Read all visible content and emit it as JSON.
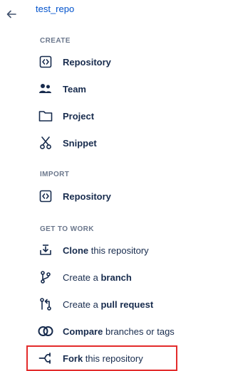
{
  "header": {
    "repo_name": "test_repo"
  },
  "create": {
    "title": "CREATE",
    "repository": "Repository",
    "team": "Team",
    "project": "Project",
    "snippet": "Snippet"
  },
  "import": {
    "title": "IMPORT",
    "repository": "Repository"
  },
  "get_to_work": {
    "title": "GET TO WORK",
    "clone": {
      "bold": "Clone",
      "rest": " this repository"
    },
    "branch": {
      "pre": "Create a ",
      "bold": "branch"
    },
    "pull_request": {
      "pre": "Create a ",
      "bold": "pull request"
    },
    "compare": {
      "bold": "Compare",
      "rest": " branches or tags"
    },
    "fork": {
      "bold": "Fork",
      "rest": " this repository"
    }
  },
  "colors": {
    "link": "#0052cc",
    "text": "#172b4d",
    "header": "#6b778c",
    "highlight": "#e32b2b"
  },
  "icons": {
    "back": "arrow-left-icon",
    "repository": "code-brackets-icon",
    "team": "people-icon",
    "project": "folder-icon",
    "snippet": "scissors-icon",
    "clone": "download-tray-icon",
    "branch": "branch-icon",
    "pull_request": "pull-request-icon",
    "compare": "compare-circles-icon",
    "fork": "fork-icon"
  }
}
